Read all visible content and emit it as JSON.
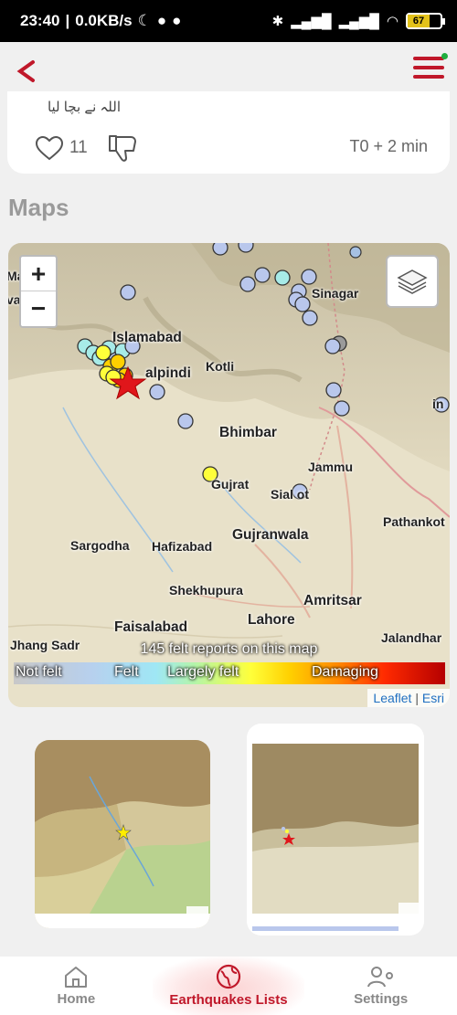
{
  "status_bar": {
    "time": "23:40",
    "network_speed": "0.0KB/s",
    "battery_level": "67"
  },
  "app_bar": {
    "back_icon": "back-chevron",
    "menu_icon": "hamburger-menu"
  },
  "testimony_card": {
    "text": "اللہ نے بچا لیا",
    "like_count": "11",
    "timestamp": "T0 + 2 min"
  },
  "maps_section": {
    "title": "Maps",
    "zoom_in": "+",
    "zoom_out": "−",
    "felt_reports_caption": "145 felt reports on this map",
    "legend": {
      "not_felt": "Not felt",
      "felt": "Felt",
      "largely_felt": "Largely felt",
      "damaging": "Damaging"
    },
    "attribution_leaflet": "Leaflet",
    "attribution_sep": " | ",
    "attribution_esri": "Esri",
    "places": {
      "islamabad": "Islamabad",
      "rawalpindi": "alpindi",
      "kotli": "Kotli",
      "bhimbar": "Bhimbar",
      "gujrat": "Gujrat",
      "sialkot": "Sial  ot",
      "jammu": "Jammu",
      "srinagar": "Sinagar",
      "pathankot": "Pathankot",
      "sargodha": "Sargodha",
      "hafizabad": "Hafizabad",
      "gujranwala": "Gujranwala",
      "shekhupura": "Shekhupura",
      "amritsar": "Amritsar",
      "lahore": "Lahore",
      "faisalabad": "Faisalabad",
      "jalandhar": "Jalandhar",
      "jhang": "Jhang Sadr",
      "edge_ma": "Ma",
      "edge_va": "va",
      "edge_in": "in"
    }
  },
  "bottom_nav": {
    "home": "Home",
    "earthquakes": "Earthquakes Lists",
    "settings": "Settings"
  },
  "colors": {
    "accent": "#c0182a",
    "epicenter_star": "#e0161b"
  }
}
